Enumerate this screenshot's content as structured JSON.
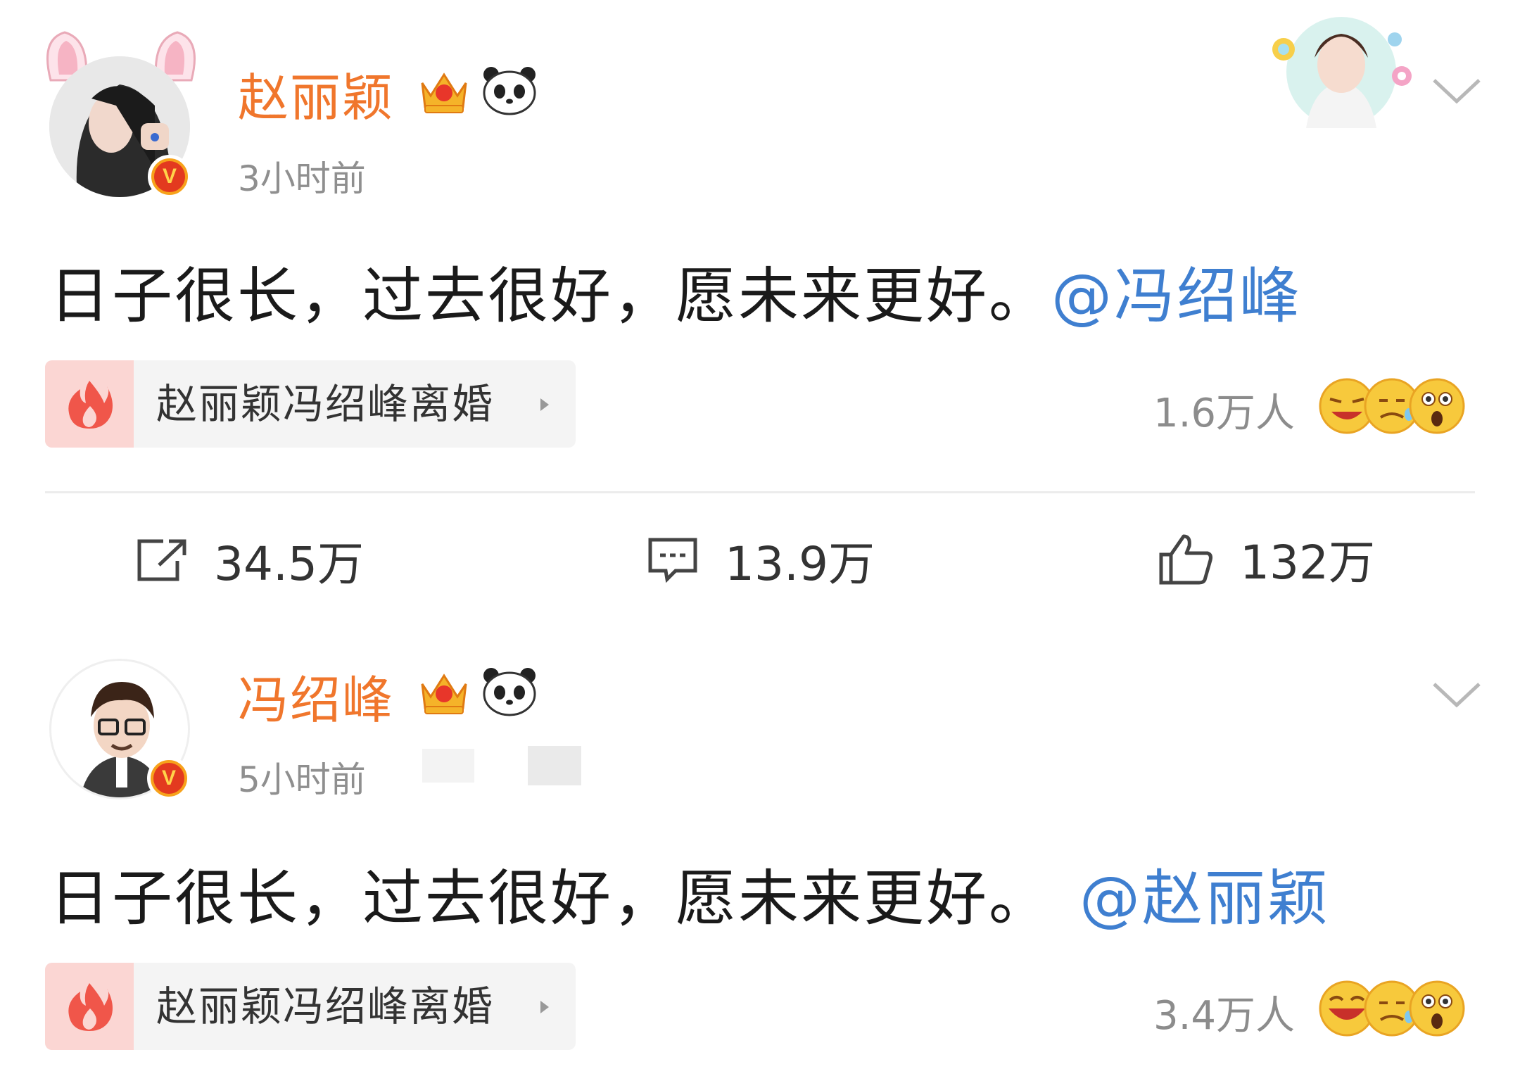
{
  "posts": [
    {
      "username": "赵丽颖",
      "time": "3小时前",
      "content": "日子很长，过去很好，愿未来更好。",
      "mention": "@冯绍峰",
      "topic": "赵丽颖冯绍峰离婚",
      "reaction_count": "1.6万人",
      "icons": [
        "crown-icon",
        "panda-icon",
        "verified-icon",
        "fire-icon",
        "chevron-down-icon"
      ]
    },
    {
      "username": "冯绍峰",
      "time": "5小时前",
      "content": "日子很长，过去很好，愿未来更好。",
      "mention": "@赵丽颖",
      "topic": "赵丽颖冯绍峰离婚",
      "reaction_count": "3.4万人",
      "icons": [
        "crown-icon",
        "panda-icon",
        "verified-icon",
        "fire-icon",
        "chevron-down-icon"
      ]
    }
  ],
  "actions": {
    "repost": "34.5万",
    "comment": "13.9万",
    "like": "132万"
  },
  "colors": {
    "username": "#f0762c",
    "mention": "#3f7fd0",
    "timestamp": "#8f8f8f",
    "fire_bg": "#fbd6d3",
    "fire": "#f0564a"
  }
}
